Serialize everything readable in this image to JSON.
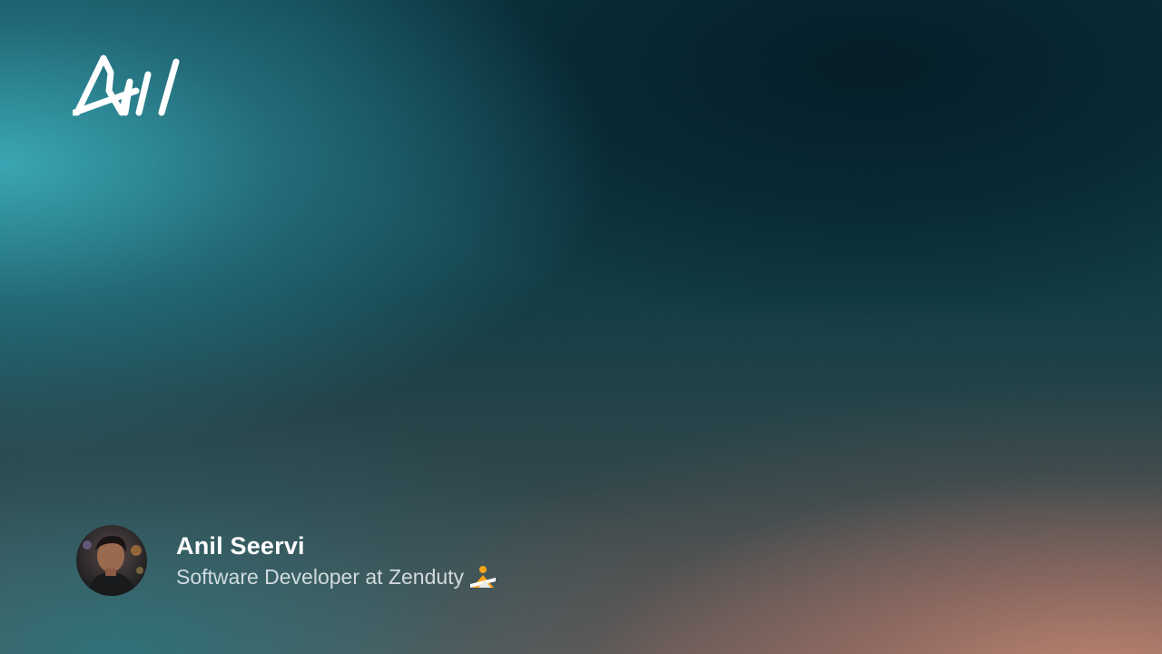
{
  "logo": {
    "icon": "signature-logo-icon",
    "stroke_color": "#ffffff"
  },
  "profile": {
    "name": "Anil Seervi",
    "role": "Software Developer at Zenduty",
    "avatar_icon": "person-photo-avatar",
    "company_icon": "zenduty-logo-icon"
  },
  "colors": {
    "teal_glow": "#3aa8b6",
    "dark_teal": "#041c26",
    "peach_glow": "#be806c",
    "name_text": "#ffffff",
    "role_text": "#ebf0f2",
    "zenduty_orange": "#f5a31a"
  }
}
